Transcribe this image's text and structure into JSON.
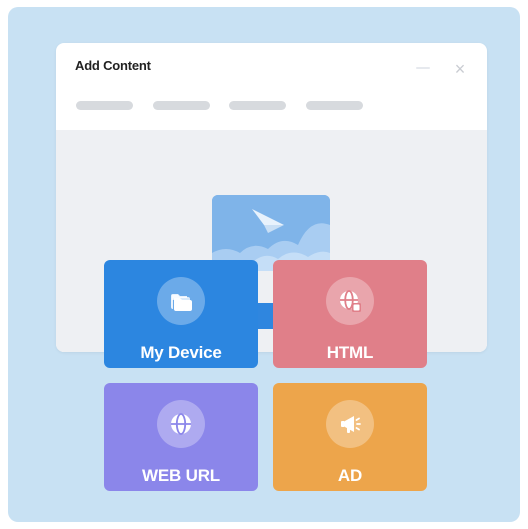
{
  "dialog": {
    "title": "Add Content",
    "close_glyph": "×",
    "tab_count_placeholder": 4
  },
  "tiles": [
    {
      "label": "My Device",
      "icon": "folder-icon",
      "color": "#2c86e0"
    },
    {
      "label": "HTML",
      "icon": "html-globe-icon",
      "color": "#e07f89"
    },
    {
      "label": "WEB URL",
      "icon": "globe-icon",
      "color": "#8b86ea"
    },
    {
      "label": "AD",
      "icon": "megaphone-icon",
      "color": "#eda54b"
    }
  ],
  "colors": {
    "frame_background": "#c8e1f3",
    "dialog_body": "#eef0f3",
    "upload_accent": "#2f86df"
  }
}
